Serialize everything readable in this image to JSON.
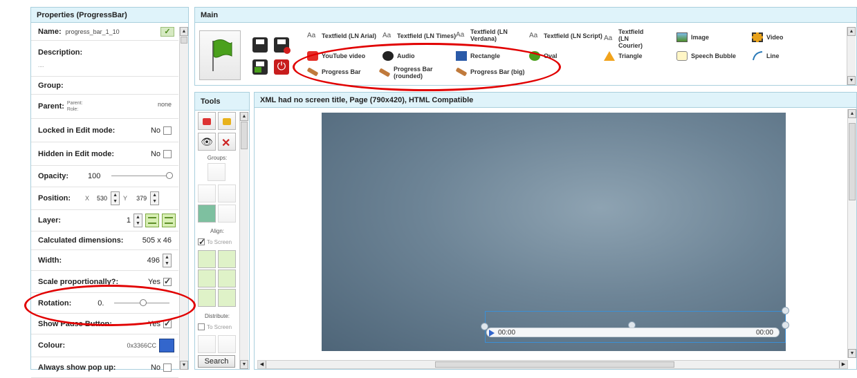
{
  "props": {
    "title": "Properties (ProgressBar)",
    "name_label": "Name:",
    "name_value": "progress_bar_1_10",
    "description_label": "Description:",
    "description_value": "....",
    "group_label": "Group:",
    "parent_label": "Parent:",
    "parent_sub": "Parent:",
    "role_sub": "Role:",
    "parent_value": "none",
    "locked_label": "Locked in Edit mode:",
    "locked_value": "No",
    "hidden_label": "Hidden in Edit mode:",
    "hidden_value": "No",
    "opacity_label": "Opacity:",
    "opacity_value": "100",
    "position_label": "Position:",
    "pos_x_label": "X",
    "pos_x_value": "530",
    "pos_y_label": "Y",
    "pos_y_value": "379",
    "layer_label": "Layer:",
    "layer_value": "1",
    "calc_label": "Calculated dimensions:",
    "calc_value": "505 x 46",
    "width_label": "Width:",
    "width_value": "496",
    "scale_label": "Scale proportionally?:",
    "scale_value": "Yes",
    "rotation_label": "Rotation:",
    "rotation_value": "0.",
    "pause_label": "Show Pause Button:",
    "pause_value": "Yes",
    "colour_label": "Colour:",
    "colour_value": "0x3366CC",
    "colour_hex": "#3366CC",
    "popup_label": "Always show pop up:",
    "popup_value": "No"
  },
  "main": {
    "title": "Main",
    "components_row1": [
      {
        "aa": "Aa",
        "label": "Textfield (LN Arial)"
      },
      {
        "aa": "Aa",
        "label": "Textfield (LN Times)"
      },
      {
        "aa": "Aa",
        "label": "Textfield (LN Verdana)"
      },
      {
        "aa": "Aa",
        "label": "Textfield (LN Script)"
      },
      {
        "aa": "Aa",
        "label": "Textfield (LN Courier)"
      },
      {
        "label": "Image"
      },
      {
        "label": "Video"
      }
    ],
    "components_row2": [
      {
        "label": "YouTube video"
      },
      {
        "label": "Audio"
      },
      {
        "label": "Rectangle"
      },
      {
        "label": "Oval"
      },
      {
        "label": "Triangle"
      },
      {
        "label": "Speech Bubble"
      },
      {
        "label": "Line"
      }
    ],
    "components_row3": [
      {
        "label": "Progress Bar"
      },
      {
        "label": "Progress Bar (rounded)"
      },
      {
        "label": "Progress Bar (big)"
      }
    ]
  },
  "tools": {
    "title": "Tools",
    "groups_label": "Groups:",
    "align_label": "Align:",
    "align_to_screen": "To Screen",
    "distribute_label": "Distribute:",
    "distribute_to_screen": "To Screen",
    "search_label": "Search"
  },
  "canvas": {
    "title": "XML had no screen title, Page (790x420), HTML Compatible",
    "time_left": "00:00",
    "time_right": "00:00"
  }
}
